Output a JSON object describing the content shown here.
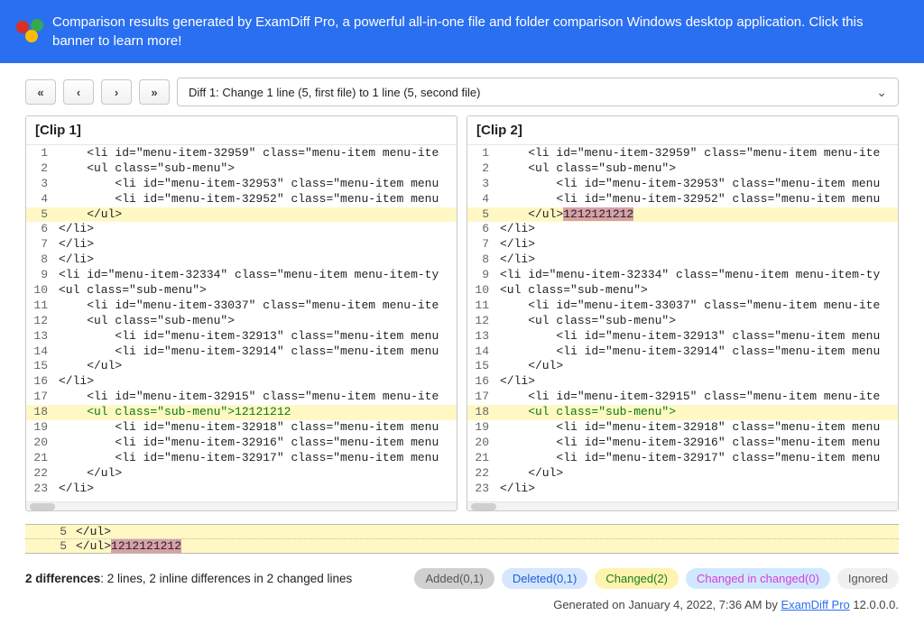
{
  "banner": {
    "text": "Comparison results generated by ExamDiff Pro, a powerful all-in-one file and folder comparison Windows desktop application. Click this banner to learn more!"
  },
  "toolbar": {
    "first": "«",
    "prev": "‹",
    "next": "›",
    "last": "»",
    "diff_label": "Diff 1: Change 1 line (5, first file) to 1 line (5, second file)"
  },
  "panes": {
    "left": {
      "title": "[Clip 1]",
      "lines": [
        {
          "n": 1,
          "t": "    <li id=\"menu-item-32959\" class=\"menu-item menu-ite",
          "changed": false
        },
        {
          "n": 2,
          "t": "    <ul class=\"sub-menu\">",
          "changed": false
        },
        {
          "n": 3,
          "t": "        <li id=\"menu-item-32953\" class=\"menu-item menu",
          "changed": false
        },
        {
          "n": 4,
          "t": "        <li id=\"menu-item-32952\" class=\"menu-item menu",
          "changed": false
        },
        {
          "n": 5,
          "t": "    </ul>",
          "changed": true
        },
        {
          "n": 6,
          "t": "</li>",
          "changed": false
        },
        {
          "n": 7,
          "t": "</li>",
          "changed": false
        },
        {
          "n": 8,
          "t": "</li>",
          "changed": false
        },
        {
          "n": 9,
          "t": "<li id=\"menu-item-32334\" class=\"menu-item menu-item-ty",
          "changed": false
        },
        {
          "n": 10,
          "t": "<ul class=\"sub-menu\">",
          "changed": false
        },
        {
          "n": 11,
          "t": "    <li id=\"menu-item-33037\" class=\"menu-item menu-ite",
          "changed": false
        },
        {
          "n": 12,
          "t": "    <ul class=\"sub-menu\">",
          "changed": false
        },
        {
          "n": 13,
          "t": "        <li id=\"menu-item-32913\" class=\"menu-item menu",
          "changed": false
        },
        {
          "n": 14,
          "t": "        <li id=\"menu-item-32914\" class=\"menu-item menu",
          "changed": false
        },
        {
          "n": 15,
          "t": "    </ul>",
          "changed": false
        },
        {
          "n": 16,
          "t": "</li>",
          "changed": false
        },
        {
          "n": 17,
          "t": "    <li id=\"menu-item-32915\" class=\"menu-item menu-ite",
          "changed": false
        },
        {
          "n": 18,
          "t": "    <ul class=\"sub-menu\">",
          "changed": true,
          "tail": "12121212",
          "tail_kind": "add"
        },
        {
          "n": 19,
          "t": "        <li id=\"menu-item-32918\" class=\"menu-item menu",
          "changed": false
        },
        {
          "n": 20,
          "t": "        <li id=\"menu-item-32916\" class=\"menu-item menu",
          "changed": false
        },
        {
          "n": 21,
          "t": "        <li id=\"menu-item-32917\" class=\"menu-item menu",
          "changed": false
        },
        {
          "n": 22,
          "t": "    </ul>",
          "changed": false
        },
        {
          "n": 23,
          "t": "</li>",
          "changed": false
        }
      ]
    },
    "right": {
      "title": "[Clip 2]",
      "lines": [
        {
          "n": 1,
          "t": "    <li id=\"menu-item-32959\" class=\"menu-item menu-ite",
          "changed": false
        },
        {
          "n": 2,
          "t": "    <ul class=\"sub-menu\">",
          "changed": false
        },
        {
          "n": 3,
          "t": "        <li id=\"menu-item-32953\" class=\"menu-item menu",
          "changed": false
        },
        {
          "n": 4,
          "t": "        <li id=\"menu-item-32952\" class=\"menu-item menu",
          "changed": false
        },
        {
          "n": 5,
          "t": "    </ul>",
          "changed": true,
          "tail": "1212121212",
          "tail_kind": "del"
        },
        {
          "n": 6,
          "t": "</li>",
          "changed": false
        },
        {
          "n": 7,
          "t": "</li>",
          "changed": false
        },
        {
          "n": 8,
          "t": "</li>",
          "changed": false
        },
        {
          "n": 9,
          "t": "<li id=\"menu-item-32334\" class=\"menu-item menu-item-ty",
          "changed": false
        },
        {
          "n": 10,
          "t": "<ul class=\"sub-menu\">",
          "changed": false
        },
        {
          "n": 11,
          "t": "    <li id=\"menu-item-33037\" class=\"menu-item menu-ite",
          "changed": false
        },
        {
          "n": 12,
          "t": "    <ul class=\"sub-menu\">",
          "changed": false
        },
        {
          "n": 13,
          "t": "        <li id=\"menu-item-32913\" class=\"menu-item menu",
          "changed": false
        },
        {
          "n": 14,
          "t": "        <li id=\"menu-item-32914\" class=\"menu-item menu",
          "changed": false
        },
        {
          "n": 15,
          "t": "    </ul>",
          "changed": false
        },
        {
          "n": 16,
          "t": "</li>",
          "changed": false
        },
        {
          "n": 17,
          "t": "    <li id=\"menu-item-32915\" class=\"menu-item menu-ite",
          "changed": false
        },
        {
          "n": 18,
          "t": "    <ul class=\"sub-menu\">",
          "changed": true,
          "all_add": true
        },
        {
          "n": 19,
          "t": "        <li id=\"menu-item-32918\" class=\"menu-item menu",
          "changed": false
        },
        {
          "n": 20,
          "t": "        <li id=\"menu-item-32916\" class=\"menu-item menu",
          "changed": false
        },
        {
          "n": 21,
          "t": "        <li id=\"menu-item-32917\" class=\"menu-item menu",
          "changed": false
        },
        {
          "n": 22,
          "t": "    </ul>",
          "changed": false
        },
        {
          "n": 23,
          "t": "</li>",
          "changed": false
        }
      ]
    }
  },
  "bottom": {
    "rows": [
      {
        "n": 5,
        "t": "    </ul>",
        "tail": ""
      },
      {
        "n": 5,
        "t": "    </ul>",
        "tail": "1212121212",
        "tail_kind": "del"
      }
    ]
  },
  "summary": {
    "bold": "2 differences",
    "rest": ": 2 lines, 2 inline differences in 2 changed lines"
  },
  "pills": {
    "added": "Added(0,1)",
    "deleted": "Deleted(0,1)",
    "changed": "Changed(2)",
    "cic": "Changed in changed(0)",
    "ignored": "Ignored"
  },
  "generated": {
    "prefix": "Generated on January 4, 2022, 7:36 AM by ",
    "link": "ExamDiff Pro",
    "suffix": " 12.0.0.0."
  }
}
